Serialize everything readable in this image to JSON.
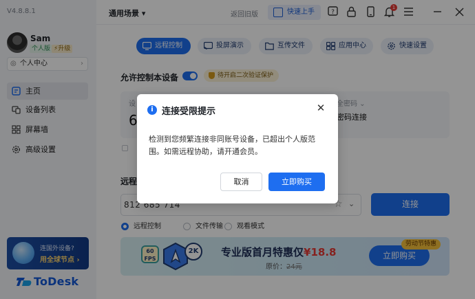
{
  "app": {
    "version": "V4.8.8.1",
    "brand": "ToDesk"
  },
  "user": {
    "name": "Sam",
    "plan": "个人版",
    "upgrade": "升级",
    "center_label": "个人中心"
  },
  "sidebar": {
    "items": [
      {
        "label": "主页",
        "icon": "home-icon",
        "active": true
      },
      {
        "label": "设备列表",
        "icon": "device-list-icon",
        "active": false
      },
      {
        "label": "屏幕墙",
        "icon": "grid-icon",
        "active": false
      },
      {
        "label": "高级设置",
        "icon": "gear-icon",
        "active": false
      }
    ]
  },
  "promo": {
    "line1": "连国外设备?",
    "line2": "用全球节点 ›"
  },
  "header": {
    "scene": "通用场景 ▾",
    "back_old": "返回旧版",
    "quick_start": "快速上手",
    "notification_count": "1"
  },
  "tabs": [
    {
      "label": "远程控制",
      "icon": "monitor-icon",
      "active": true
    },
    {
      "label": "投屏演示",
      "icon": "cast-icon",
      "active": false
    },
    {
      "label": "互传文件",
      "icon": "folder-icon",
      "active": false
    },
    {
      "label": "应用中心",
      "icon": "apps-icon",
      "active": false
    },
    {
      "label": "快速设置",
      "icon": "gear-icon",
      "active": false
    }
  ],
  "main": {
    "allow_control": "允许控制本设备",
    "twofa_warning": "待开启二次验证保护",
    "device_code_label": "设",
    "device_code_value": "6",
    "password_label": "全密码 ⌄",
    "password_action": "密码连接",
    "remote_label": "远程",
    "remote_input_value": "812 685 714",
    "connect_button": "连接",
    "modes": [
      "远程控制",
      "文件传输",
      "观看模式"
    ]
  },
  "banner": {
    "fps": "60\nFPS",
    "resolution": "2K",
    "title_prefix": "专业版首月特惠仅",
    "title_price": "¥18.8",
    "original_price_label": "原价：",
    "original_price": "24元",
    "buy_button": "立即购买",
    "tag": "劳动节特惠"
  },
  "modal": {
    "title": "连接受限提示",
    "body": "检测到您频繁连接非同账号设备，已超出个人版范围。如需远程协助，请开通会员。",
    "cancel": "取消",
    "confirm": "立即购买"
  },
  "colors": {
    "accent": "#1e6ef0",
    "sidebar_bg": "#f3f5f9",
    "badge_red": "#e53935"
  }
}
